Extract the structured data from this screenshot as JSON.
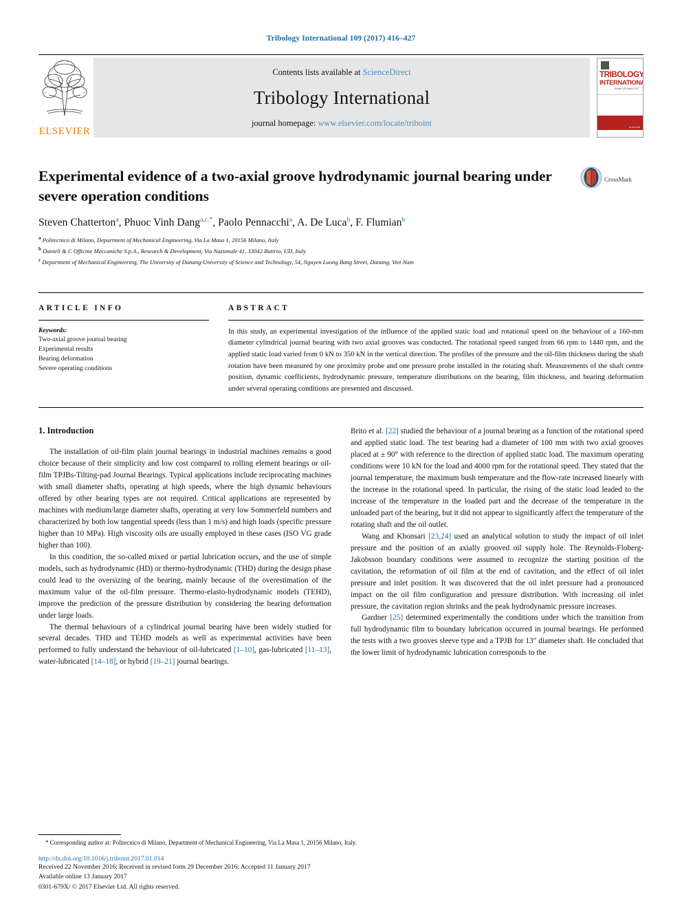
{
  "running_head": "Tribology International 109 (2017) 416–427",
  "masthead": {
    "publisher_name": "ELSEVIER",
    "contents_prefix": "Contents lists available at",
    "contents_link": "ScienceDirect",
    "journal_name": "Tribology International",
    "homepage_prefix": "journal homepage:",
    "homepage_url": "www.elsevier.com/locate/triboint",
    "cover_title_line1": "TRIBOLOGY",
    "cover_title_line2": "INTERNATIONAL",
    "cover_subtitle": "Volume 109 August 2017",
    "accent_blue": "#4a8fc0",
    "accent_orange": "#f07c00",
    "cover_red": "#b4231f"
  },
  "article": {
    "title": "Experimental evidence of a two-axial groove hydrodynamic journal bearing under severe operation conditions",
    "crossmark_label": "CrossMark",
    "authors": [
      {
        "name": "Steven Chatterton",
        "sup": "a"
      },
      {
        "name": "Phuoc Vinh Dang",
        "sup": "a,c,*"
      },
      {
        "name": "Paolo Pennacchi",
        "sup": "a"
      },
      {
        "name": "A. De Luca",
        "sup": "b"
      },
      {
        "name": "F. Flumian",
        "sup": "b"
      }
    ],
    "affiliations": [
      {
        "marker": "a",
        "text": "Politecnico di Milano, Department of Mechanical Engineering, Via La Masa 1, 20156 Milano, Italy"
      },
      {
        "marker": "b",
        "text": "Danieli & C Officine Meccaniche S.p.A., Research & Development, Via Nazionale 41, 33042 Buttrio, UD, Italy"
      },
      {
        "marker": "c",
        "text": "Department of Mechanical Engineering, The University of Danang-University of Science and Technology, 54, Nguyen Luong Bang Street, Danang, Viet Nam"
      }
    ]
  },
  "article_info": {
    "heading": "ARTICLE INFO",
    "keywords_label": "Keywords:",
    "keywords": [
      "Two-axial groove journal bearing",
      "Experimental results",
      "Bearing deformation",
      "Severe operating conditions"
    ]
  },
  "abstract": {
    "heading": "ABSTRACT",
    "text": "In this study, an experimental investigation of the influence of the applied static load and rotational speed on the behaviour of a 160-mm diameter cylindrical journal bearing with two axial grooves was conducted. The rotational speed ranged from 66 rpm to 1440 rpm, and the applied static load varied from 0 kN to 350 kN in the vertical direction. The profiles of the pressure and the oil-film thickness during the shaft rotation have been measured by one proximity probe and one pressure probe installed in the rotating shaft. Measurements of the shaft centre position, dynamic coefficients, hydrodynamic pressure, temperature distributions on the bearing, film thickness, and bearing deformation under several operating conditions are presented and discussed."
  },
  "introduction": {
    "heading": "1. Introduction",
    "left_paragraphs": [
      "The installation of oil-film plain journal bearings in industrial machines remains a good choice because of their simplicity and low cost compared to rolling element bearings or oil-film TPJBs-Tilting-pad Journal Bearings. Typical applications include reciprocating machines with small diameter shafts, operating at high speeds, where the high dynamic behaviours offered by other bearing types are not required. Critical applications are represented by machines with medium/large diameter shafts, operating at very low Sommerfeld numbers and characterized by both low tangential speeds (less than 1 m/s) and high loads (specific pressure higher than 10 MPa). High viscosity oils are usually employed in these cases (ISO VG grade higher than 100).",
      "In this condition, the so-called mixed or partial lubrication occurs, and the use of simple models, such as hydrodynamic (HD) or thermo-hydrodynamic (THD) during the design phase could lead to the oversizing of the bearing, mainly because of the overestimation of the maximum value of the oil-film pressure. Thermo-elasto-hydrodynamic models (TEHD), improve the prediction of the pressure distribution by considering the bearing deformation under large loads."
    ],
    "left_last_paragraph_parts": [
      "The thermal behaviours of a cylindrical journal bearing have been widely studied for several decades. THD and TEHD models as well as experimental activities have been performed to fully understand the behaviour of oil-lubricated ",
      "[1–10]",
      ", gas-lubricated ",
      "[11–13]",
      ", water-lubricated ",
      "[14–18]",
      ", or hybrid ",
      "[19–21]",
      " journal bearings."
    ],
    "right_para1_parts": [
      "Brito et al. ",
      "[22]",
      " studied the behaviour of a journal bearing as a function of the rotational speed and applied static load. The test bearing had a diameter of 100 mm with two axial grooves placed at ± 90° with reference to the direction of applied static load. The maximum operating conditions were 10 kN for the load and 4000 rpm for the rotational speed. They stated that the journal temperature, the maximum bush temperature and the flow-rate increased linearly with the increase in the rotational speed. In particular, the rising of the static load leaded to the increase of the temperature in the loaded part and the decrease of the temperature in the unloaded part of the bearing, but it did not appear to significantly affect the temperature of the rotating shaft and the oil outlet."
    ],
    "right_para2_parts": [
      "Wang and Khonsari ",
      "[23,24]",
      " used an analytical solution to study the impact of oil inlet pressure and the position of an axially grooved oil supply hole. The Reynolds-Floberg-Jakobsson boundary conditions were assumed to recognize the starting position of the cavitation, the reformation of oil film at the end of cavitation, and the effect of oil inlet pressure and inlet position. It was discovered that the oil inlet pressure had a pronounced impact on the oil film configuration and pressure distribution. With increasing oil inlet pressure, the cavitation region shrinks and the peak hydrodynamic pressure increases."
    ],
    "right_para3_parts": [
      "Gardner ",
      "[25]",
      " determined experimentally the conditions under which the transition from full hydrodynamic film to boundary lubrication occurred in journal bearings. He performed the tests with a two grooves sleeve type and a TPJB for 13″ diameter shaft. He concluded that the lower limit of hydrodynamic lubrication corresponds to the"
    ]
  },
  "footer": {
    "corresponding_note": "* Corresponding author at: Politecnico di Milano, Department of Mechanical Engineering, Via La Masa 1, 20156 Milano, Italy.",
    "doi": "http://dx.doi.org/10.1016/j.triboint.2017.01.014",
    "history": "Received 22 November 2016; Received in revised form 29 December 2016; Accepted 11 January 2017",
    "available": "Available online 13 January 2017",
    "copyright": "0301-679X/ © 2017 Elsevier Ltd. All rights reserved."
  }
}
